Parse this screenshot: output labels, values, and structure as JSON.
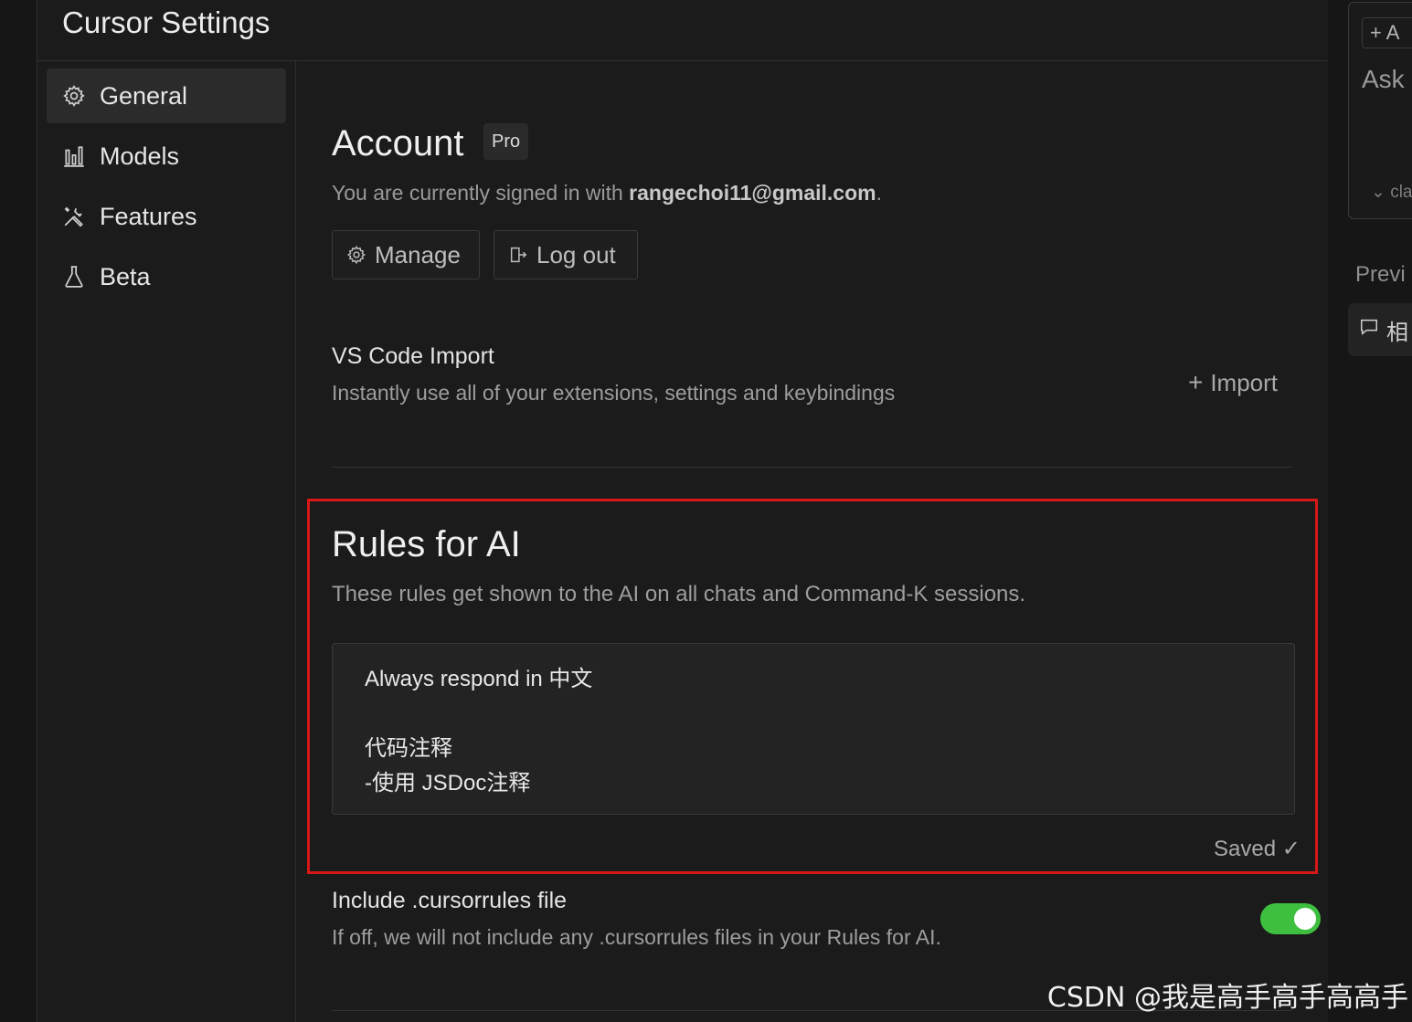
{
  "header": {
    "title": "Cursor Settings"
  },
  "sidebar": {
    "items": [
      {
        "label": "General",
        "icon": "gear-icon",
        "active": true
      },
      {
        "label": "Models",
        "icon": "chart-bars-icon",
        "active": false
      },
      {
        "label": "Features",
        "icon": "tools-icon",
        "active": false
      },
      {
        "label": "Beta",
        "icon": "flask-icon",
        "active": false
      }
    ]
  },
  "account": {
    "title": "Account",
    "badge": "Pro",
    "signed_prefix": "You are currently signed in with ",
    "email": "rangechoi11@gmail.com",
    "signed_suffix": ".",
    "manage_label": "Manage",
    "logout_label": "Log out"
  },
  "vscode_import": {
    "title": "VS Code Import",
    "description": "Instantly use all of your extensions, settings and keybindings",
    "import_label": "Import"
  },
  "rules_for_ai": {
    "title": "Rules for AI",
    "description": "These rules get shown to the AI on all chats and Command-K sessions.",
    "value": "Always respond in 中文\n\n代码注释\n-使用 JSDoc注释",
    "status": "Saved ✓"
  },
  "cursorrules": {
    "title": "Include .cursorrules file",
    "description": "If off, we will not include any .cursorrules files in your Rules for AI.",
    "enabled": true
  },
  "right_panel": {
    "add_label": "+ A",
    "ask_label": "Ask",
    "model_label": "cla",
    "preview_label": "Previ",
    "chip_label": "相"
  },
  "colors": {
    "accent_toggle": "#3fbf3f",
    "highlight_border": "#d81818"
  },
  "watermark": "CSDN @我是高手高手高高手"
}
